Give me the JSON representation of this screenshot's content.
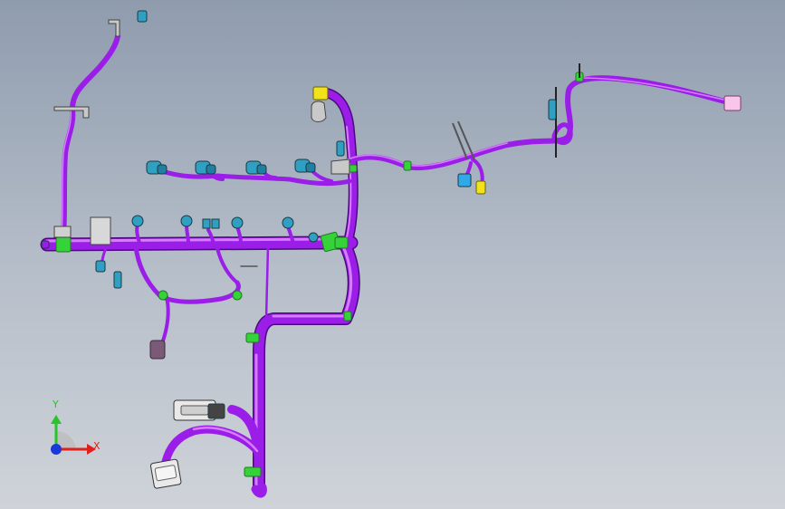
{
  "viewport": {
    "background_top": "#8f9cae",
    "background_bottom": "#cfd3d9"
  },
  "colors": {
    "harness": "#9a1ee8",
    "harness_highlight": "#d87cff",
    "harness_shadow": "#5a0a92",
    "clip_green": "#35d23a",
    "connector_teal": "#2f9fc2",
    "connector_yellow": "#f2e21a",
    "connector_pink": "#f7c6ea",
    "bracket_gray": "#b9b9b9",
    "white_connector": "#e9e9e9",
    "brown_connector": "#7b5a78"
  },
  "triad": {
    "x_label": "X",
    "y_label": "Y",
    "x_color": "#e0201a",
    "y_color": "#27c42a",
    "z_color": "#1a3ad8"
  },
  "icons": [
    "harness-branch",
    "connector-icon",
    "clip-icon",
    "bracket-icon",
    "coordinate-triad-icon"
  ]
}
